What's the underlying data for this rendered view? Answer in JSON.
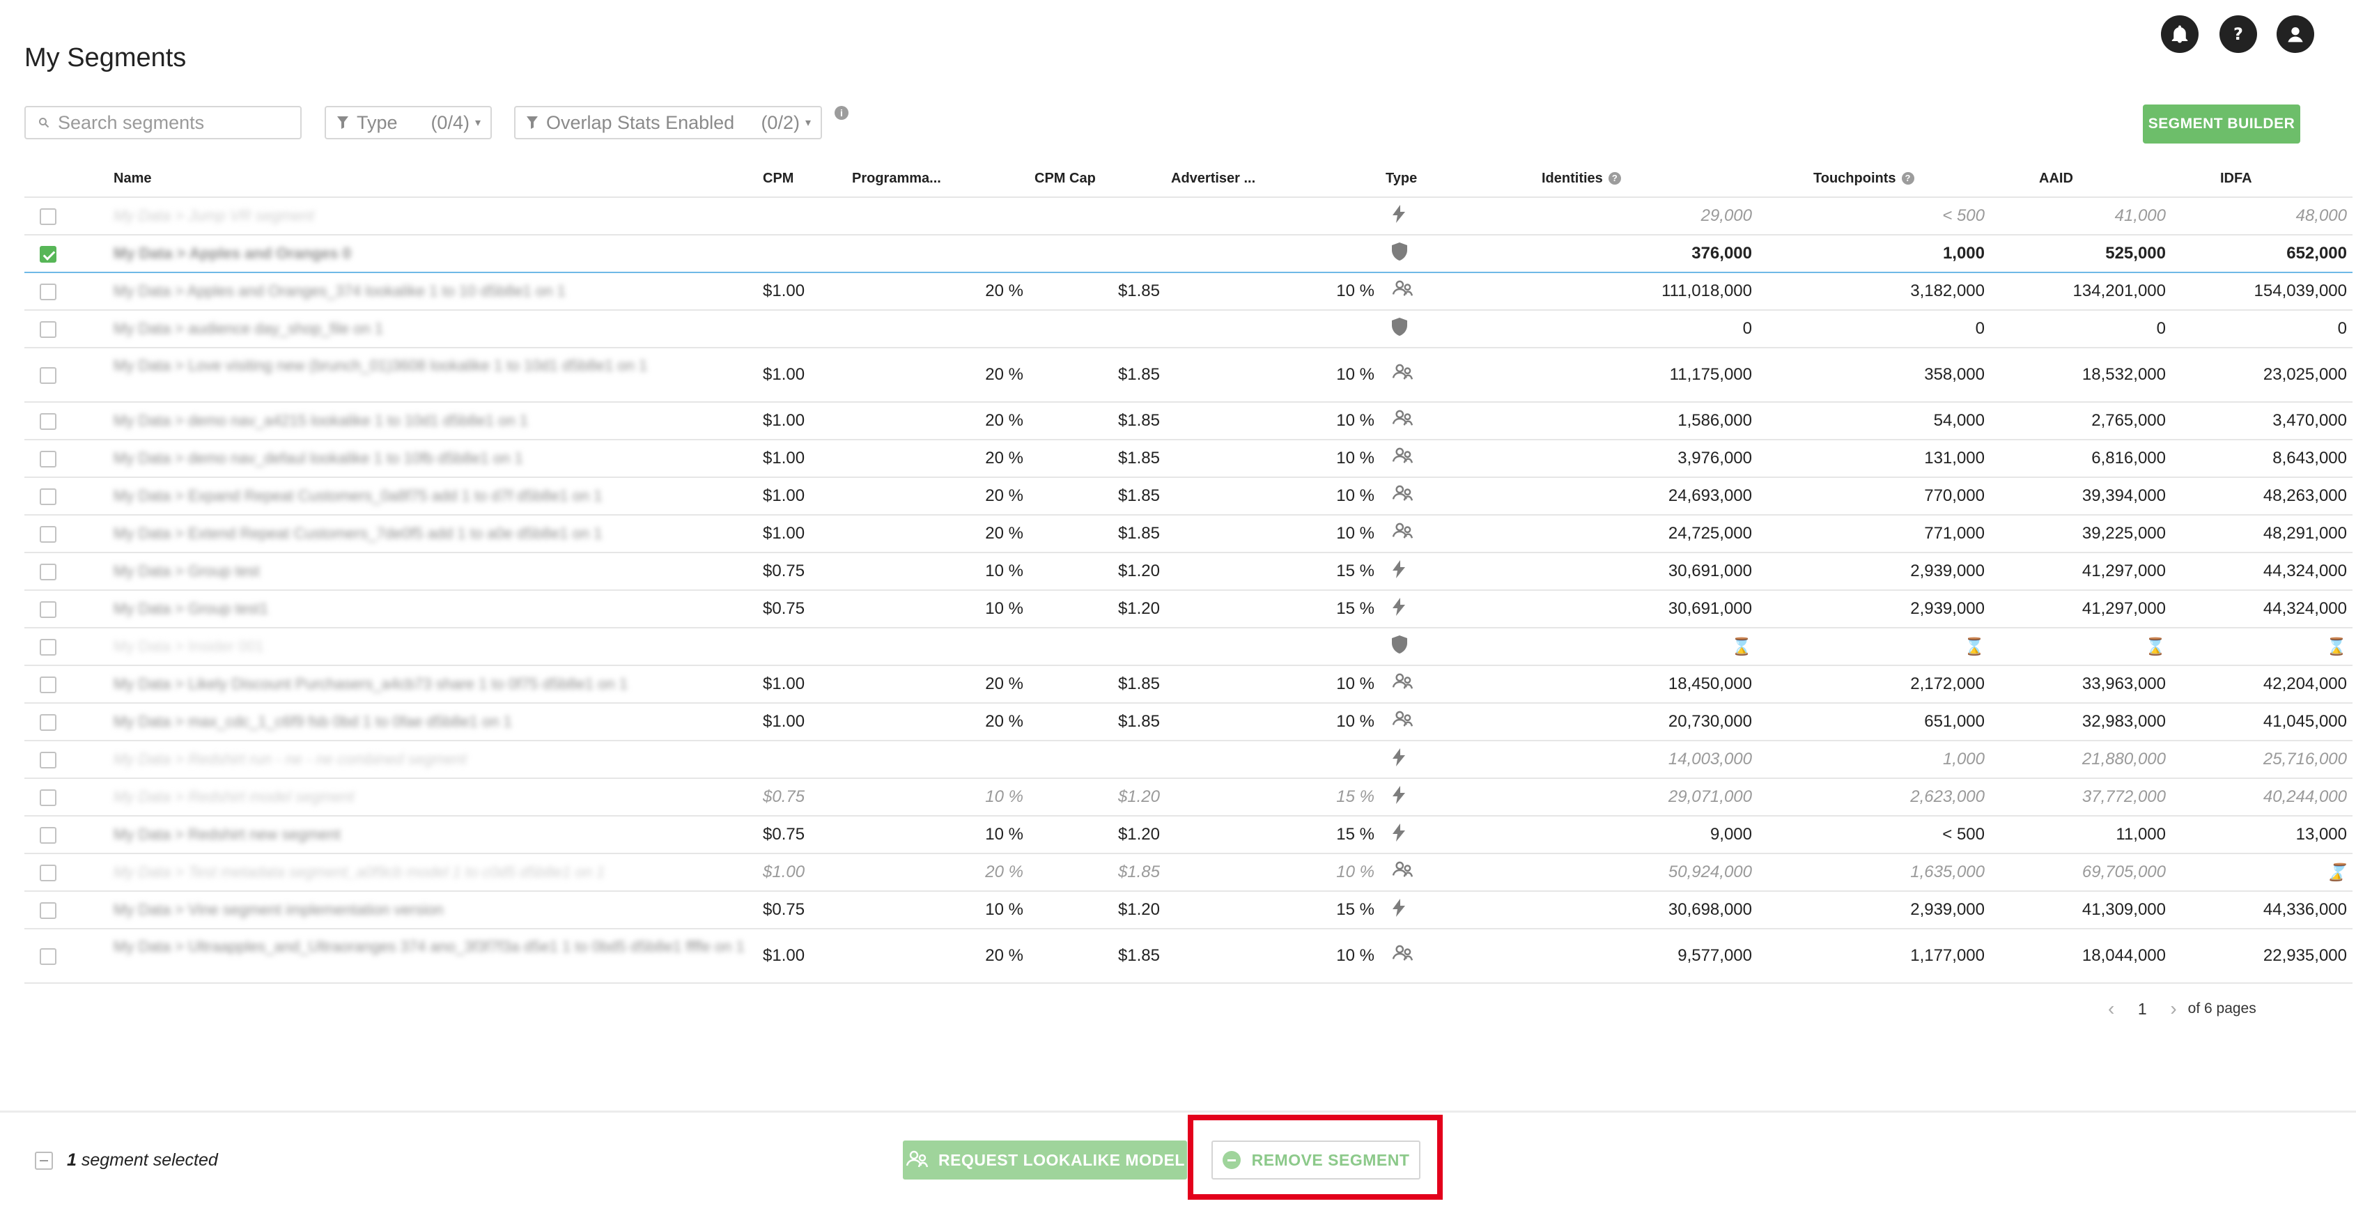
{
  "header": {
    "title": "My Segments"
  },
  "toolbar": {
    "search_placeholder": "Search segments",
    "filter_type_label": "Type",
    "filter_type_count": "(0/4)",
    "filter_overlap_label": "Overlap Stats Enabled",
    "filter_overlap_count": "(0/2)",
    "builder_label": "SEGMENT BUILDER"
  },
  "table": {
    "columns": [
      "Name",
      "CPM",
      "Programma...",
      "CPM Cap",
      "Advertiser ...",
      "Type",
      "Identities",
      "Touchpoints",
      "AAID",
      "IDFA"
    ],
    "rows": [
      {
        "name": "My Data > Jump VR segment",
        "cpm": "",
        "prog": "",
        "cap": "",
        "adv": "",
        "type": "bolt",
        "identities": "29,000",
        "touchpoints": "< 500",
        "aaid": "41,000",
        "idfa": "48,000",
        "dim": true
      },
      {
        "name": "My Data > Apples and Oranges 0",
        "cpm": "",
        "prog": "",
        "cap": "",
        "adv": "",
        "type": "shield",
        "identities": "376,000",
        "touchpoints": "1,000",
        "aaid": "525,000",
        "idfa": "652,000",
        "selected": true
      },
      {
        "name": "My Data > Apples and Oranges_374 lookalike 1 to 10 d5b8e1 on 1",
        "cpm": "$1.00",
        "prog": "20 %",
        "cap": "$1.85",
        "adv": "10 %",
        "type": "lookalike",
        "identities": "111,018,000",
        "touchpoints": "3,182,000",
        "aaid": "134,201,000",
        "idfa": "154,039,000"
      },
      {
        "name": "My Data > audience day_shop_file on 1",
        "cpm": "",
        "prog": "",
        "cap": "",
        "adv": "",
        "type": "shield",
        "identities": "0",
        "touchpoints": "0",
        "aaid": "0",
        "idfa": "0"
      },
      {
        "name": "My Data > Love visiting new (brunch_01)3608 lookalike 1 to 10d1 d5b8e1 on 1",
        "cpm": "$1.00",
        "prog": "20 %",
        "cap": "$1.85",
        "adv": "10 %",
        "type": "lookalike",
        "identities": "11,175,000",
        "touchpoints": "358,000",
        "aaid": "18,532,000",
        "idfa": "23,025,000",
        "two": true
      },
      {
        "name": "My Data > demo nav_a4215 lookalike 1 to 10d1 d5b8e1 on 1",
        "cpm": "$1.00",
        "prog": "20 %",
        "cap": "$1.85",
        "adv": "10 %",
        "type": "lookalike",
        "identities": "1,586,000",
        "touchpoints": "54,000",
        "aaid": "2,765,000",
        "idfa": "3,470,000"
      },
      {
        "name": "My Data > demo nav_defaul lookalike 1 to 10fb d5b8e1 on 1",
        "cpm": "$1.00",
        "prog": "20 %",
        "cap": "$1.85",
        "adv": "10 %",
        "type": "lookalike",
        "identities": "3,976,000",
        "touchpoints": "131,000",
        "aaid": "6,816,000",
        "idfa": "8,643,000"
      },
      {
        "name": "My Data > Expand Repeat Customers_0a8f75 add 1 to d7f d5b8e1 on 1",
        "cpm": "$1.00",
        "prog": "20 %",
        "cap": "$1.85",
        "adv": "10 %",
        "type": "lookalike",
        "identities": "24,693,000",
        "touchpoints": "770,000",
        "aaid": "39,394,000",
        "idfa": "48,263,000"
      },
      {
        "name": "My Data > Extend Repeat Customers_7de0f5 add 1 to a0e d5b8e1 on 1",
        "cpm": "$1.00",
        "prog": "20 %",
        "cap": "$1.85",
        "adv": "10 %",
        "type": "lookalike",
        "identities": "24,725,000",
        "touchpoints": "771,000",
        "aaid": "39,225,000",
        "idfa": "48,291,000"
      },
      {
        "name": "My Data > Group test",
        "cpm": "$0.75",
        "prog": "10 %",
        "cap": "$1.20",
        "adv": "15 %",
        "type": "bolt",
        "identities": "30,691,000",
        "touchpoints": "2,939,000",
        "aaid": "41,297,000",
        "idfa": "44,324,000"
      },
      {
        "name": "My Data > Group test1",
        "cpm": "$0.75",
        "prog": "10 %",
        "cap": "$1.20",
        "adv": "15 %",
        "type": "bolt",
        "identities": "30,691,000",
        "touchpoints": "2,939,000",
        "aaid": "41,297,000",
        "idfa": "44,324,000"
      },
      {
        "name": "My Data > Insider 001",
        "cpm": "",
        "prog": "",
        "cap": "",
        "adv": "",
        "type": "shield",
        "identities": "⌛",
        "touchpoints": "⌛",
        "aaid": "⌛",
        "idfa": "⌛",
        "dimname": true
      },
      {
        "name": "My Data > Likely Discount Purchasers_a4cb73 share 1 to 0f75 d5b8e1 on 1",
        "cpm": "$1.00",
        "prog": "20 %",
        "cap": "$1.85",
        "adv": "10 %",
        "type": "lookalike",
        "identities": "18,450,000",
        "touchpoints": "2,172,000",
        "aaid": "33,963,000",
        "idfa": "42,204,000"
      },
      {
        "name": "My Data > max_cdc_1_c6f9 fsb 0bd 1 to 0fae d5b8e1 on 1",
        "cpm": "$1.00",
        "prog": "20 %",
        "cap": "$1.85",
        "adv": "10 %",
        "type": "lookalike",
        "identities": "20,730,000",
        "touchpoints": "651,000",
        "aaid": "32,983,000",
        "idfa": "41,045,000"
      },
      {
        "name": "My Data > Redshirt run - ne - ne combined segment",
        "cpm": "",
        "prog": "",
        "cap": "",
        "adv": "",
        "type": "bolt",
        "identities": "14,003,000",
        "touchpoints": "1,000",
        "aaid": "21,880,000",
        "idfa": "25,716,000",
        "dim": true
      },
      {
        "name": "My Data > Redshirt model segment",
        "cpm": "$0.75",
        "prog": "10 %",
        "cap": "$1.20",
        "adv": "15 %",
        "type": "bolt",
        "identities": "29,071,000",
        "touchpoints": "2,623,000",
        "aaid": "37,772,000",
        "idfa": "40,244,000",
        "dim": true
      },
      {
        "name": "My Data > Redshirt new segment",
        "cpm": "$0.75",
        "prog": "10 %",
        "cap": "$1.20",
        "adv": "15 %",
        "type": "bolt",
        "identities": "9,000",
        "touchpoints": "< 500",
        "aaid": "11,000",
        "idfa": "13,000"
      },
      {
        "name": "My Data > Test metadata segment_a0f9cb model 1 to c0d5 d5b8e1 on 1",
        "cpm": "$1.00",
        "prog": "20 %",
        "cap": "$1.85",
        "adv": "10 %",
        "type": "lookalike",
        "identities": "50,924,000",
        "touchpoints": "1,635,000",
        "aaid": "69,705,000",
        "idfa": "⌛",
        "dim": true
      },
      {
        "name": "My Data > Vine segment implementation version",
        "cpm": "$0.75",
        "prog": "10 %",
        "cap": "$1.20",
        "adv": "15 %",
        "type": "bolt",
        "identities": "30,698,000",
        "touchpoints": "2,939,000",
        "aaid": "41,309,000",
        "idfa": "44,336,000"
      },
      {
        "name": "My Data > Ultraapples_and_Ultraoranges 374 ano_3f3f7f3a d5e1 1 to 0bd5 d5b8e1 ffffe on 1",
        "cpm": "$1.00",
        "prog": "20 %",
        "cap": "$1.85",
        "adv": "10 %",
        "type": "lookalike",
        "identities": "9,577,000",
        "touchpoints": "1,177,000",
        "aaid": "18,044,000",
        "idfa": "22,935,000",
        "two": true
      }
    ]
  },
  "pagination": {
    "current": "1",
    "of_label": "of 6 pages"
  },
  "footer": {
    "selected_count": "1",
    "selected_label": "segment selected",
    "lookalike_label": "REQUEST LOOKALIKE MODEL",
    "remove_label": "REMOVE SEGMENT"
  },
  "colors": {
    "accent_green": "#6dbe6a",
    "selection_blue": "#6fb9e6",
    "highlight_red": "#e3001b"
  },
  "icons": {
    "bolt": "lightning-icon",
    "shield": "shield-icon",
    "lookalike": "lookalike-icon"
  }
}
